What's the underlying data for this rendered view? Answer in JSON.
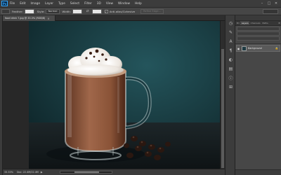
{
  "app": {
    "logo": "Ps"
  },
  "menu": [
    "File",
    "Edit",
    "Image",
    "Layer",
    "Type",
    "Select",
    "Filter",
    "3D",
    "View",
    "Window",
    "Help"
  ],
  "window_controls": {
    "minimize": "–",
    "maximize": "□",
    "close": "✕"
  },
  "options": {
    "feather_label": "Feather:",
    "style_label": "Style:",
    "style_value": "Normal",
    "width_label": "Width:",
    "anti_alias_check": "✓",
    "anti_alias_label": "Anti-alias/Cohesive",
    "refine_edge_label": "Refine Edge..."
  },
  "document": {
    "tab_label": "food drink 7.jpg @ 33.3% (RGB/8)",
    "tab_close": "×"
  },
  "status": {
    "zoom": "33.33%",
    "doc_info": "Doc: 22.4M/22.4M",
    "arrow": "▶"
  },
  "panels": {
    "tabs": [
      "3D",
      "Layers",
      "Channels",
      "Paths"
    ],
    "active_tab_index": 1,
    "menu_icon": "≡",
    "layer": {
      "name": "Background",
      "eye": "◉",
      "lock": "🔒"
    }
  },
  "colors": {
    "canvas_bg": "#1c4148",
    "panel_bg": "#474747",
    "ui_dark": "#282828"
  },
  "dock_icons": [
    "history-icon",
    "brush-icon",
    "character-icon",
    "paragraph-icon",
    "adjustments-icon",
    "properties-icon",
    "info-icon",
    "tool-presets-icon"
  ]
}
